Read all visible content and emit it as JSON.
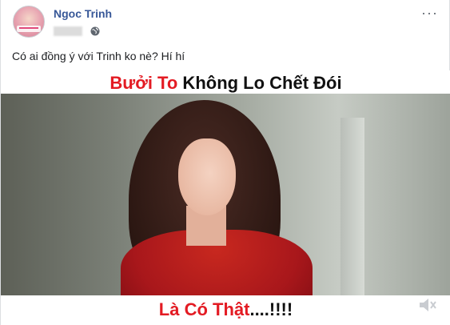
{
  "post": {
    "author": "Ngoc Trinh",
    "more_label": "···",
    "text": "Có ai đồng ý với Trinh ko nè? Hí hí"
  },
  "video": {
    "caption_top_red": "Bưởi To",
    "caption_top_black": " Không Lo Chết Đói",
    "caption_bottom_red": "Là Có Thật",
    "caption_bottom_black": "....!!!!",
    "icons": {
      "mute": "speaker-muted-icon",
      "privacy": "globe-icon"
    }
  },
  "colors": {
    "author_link": "#385898",
    "caption_accent": "#e31b23"
  }
}
